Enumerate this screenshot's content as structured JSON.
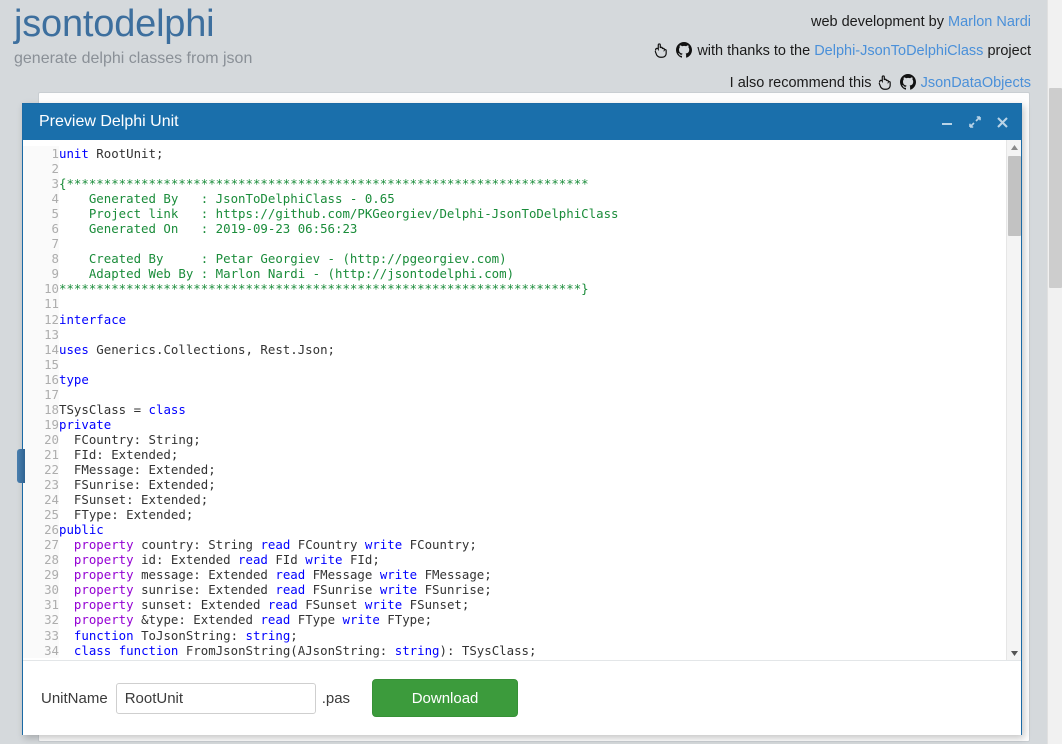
{
  "header": {
    "brand_title": "jsontodelphi",
    "brand_subtitle": "generate delphi classes from json",
    "credit_line1_prefix": "web development by",
    "credit_line1_link": "Marlon Nardi",
    "credit_line2_prefix": "with thanks to the",
    "credit_line2_link": "Delphi-JsonToDelphiClass",
    "credit_line2_suffix": "project",
    "credit_line3_prefix": "I also recommend this",
    "credit_line3_link": "JsonDataObjects",
    "icons": {
      "hand": "hand-pointer-icon",
      "github": "github-icon"
    },
    "colors": {
      "brand": "#3d6f9e",
      "link": "#4a90d9",
      "subtitle": "#8a9097"
    }
  },
  "dialog": {
    "title": "Preview Delphi Unit",
    "titlebar_color": "#1a6fab",
    "window_buttons": [
      {
        "name": "minimize-button",
        "glyph": "minimize"
      },
      {
        "name": "maximize-button",
        "glyph": "expand"
      },
      {
        "name": "close-button",
        "glyph": "close"
      }
    ]
  },
  "code": {
    "language": "delphi",
    "first_line": 1,
    "colors": {
      "keyword": "#0000ff",
      "property": "#9400d3",
      "comment": "#1a8c3a",
      "text": "#333333",
      "gutter": "#adadad"
    },
    "lines": [
      {
        "n": 1,
        "tokens": [
          {
            "t": "unit",
            "c": "k"
          },
          {
            "t": " RootUnit;",
            "c": "id"
          }
        ]
      },
      {
        "n": 2,
        "tokens": []
      },
      {
        "n": 3,
        "tokens": [
          {
            "t": "{**********************************************************************",
            "c": "cm"
          }
        ]
      },
      {
        "n": 4,
        "tokens": [
          {
            "t": "    Generated By   : JsonToDelphiClass - 0.65",
            "c": "cm"
          }
        ]
      },
      {
        "n": 5,
        "tokens": [
          {
            "t": "    Project link   : https://github.com/PKGeorgiev/Delphi-JsonToDelphiClass",
            "c": "cm"
          }
        ]
      },
      {
        "n": 6,
        "tokens": [
          {
            "t": "    Generated On   : 2019-09-23 06:56:23",
            "c": "cm"
          }
        ]
      },
      {
        "n": 7,
        "tokens": []
      },
      {
        "n": 8,
        "tokens": [
          {
            "t": "    Created By     : Petar Georgiev - (http://pgeorgiev.com)",
            "c": "cm"
          }
        ]
      },
      {
        "n": 9,
        "tokens": [
          {
            "t": "    Adapted Web By : Marlon Nardi - (http://jsontodelphi.com)",
            "c": "cm"
          }
        ]
      },
      {
        "n": 10,
        "tokens": [
          {
            "t": "**********************************************************************}",
            "c": "cm"
          }
        ]
      },
      {
        "n": 11,
        "tokens": []
      },
      {
        "n": 12,
        "tokens": [
          {
            "t": "interface",
            "c": "k"
          }
        ]
      },
      {
        "n": 13,
        "tokens": []
      },
      {
        "n": 14,
        "tokens": [
          {
            "t": "uses",
            "c": "k"
          },
          {
            "t": " Generics.Collections, Rest.Json;",
            "c": "id"
          }
        ]
      },
      {
        "n": 15,
        "tokens": []
      },
      {
        "n": 16,
        "tokens": [
          {
            "t": "type",
            "c": "k"
          }
        ]
      },
      {
        "n": 17,
        "tokens": []
      },
      {
        "n": 18,
        "tokens": [
          {
            "t": "TSysClass = ",
            "c": "id"
          },
          {
            "t": "class",
            "c": "k"
          }
        ]
      },
      {
        "n": 19,
        "tokens": [
          {
            "t": "private",
            "c": "k"
          }
        ]
      },
      {
        "n": 20,
        "tokens": [
          {
            "t": "  FCountry: String;",
            "c": "id"
          }
        ]
      },
      {
        "n": 21,
        "tokens": [
          {
            "t": "  FId: Extended;",
            "c": "id"
          }
        ]
      },
      {
        "n": 22,
        "tokens": [
          {
            "t": "  FMessage: Extended;",
            "c": "id"
          }
        ]
      },
      {
        "n": 23,
        "tokens": [
          {
            "t": "  FSunrise: Extended;",
            "c": "id"
          }
        ]
      },
      {
        "n": 24,
        "tokens": [
          {
            "t": "  FSunset: Extended;",
            "c": "id"
          }
        ]
      },
      {
        "n": 25,
        "tokens": [
          {
            "t": "  FType: Extended;",
            "c": "id"
          }
        ]
      },
      {
        "n": 26,
        "tokens": [
          {
            "t": "public",
            "c": "k"
          }
        ]
      },
      {
        "n": 27,
        "tokens": [
          {
            "t": "  ",
            "c": "id"
          },
          {
            "t": "property",
            "c": "kp"
          },
          {
            "t": " country: String ",
            "c": "id"
          },
          {
            "t": "read",
            "c": "k"
          },
          {
            "t": " FCountry ",
            "c": "id"
          },
          {
            "t": "write",
            "c": "k"
          },
          {
            "t": " FCountry;",
            "c": "id"
          }
        ]
      },
      {
        "n": 28,
        "tokens": [
          {
            "t": "  ",
            "c": "id"
          },
          {
            "t": "property",
            "c": "kp"
          },
          {
            "t": " id: Extended ",
            "c": "id"
          },
          {
            "t": "read",
            "c": "k"
          },
          {
            "t": " FId ",
            "c": "id"
          },
          {
            "t": "write",
            "c": "k"
          },
          {
            "t": " FId;",
            "c": "id"
          }
        ]
      },
      {
        "n": 29,
        "tokens": [
          {
            "t": "  ",
            "c": "id"
          },
          {
            "t": "property",
            "c": "kp"
          },
          {
            "t": " message: Extended ",
            "c": "id"
          },
          {
            "t": "read",
            "c": "k"
          },
          {
            "t": " FMessage ",
            "c": "id"
          },
          {
            "t": "write",
            "c": "k"
          },
          {
            "t": " FMessage;",
            "c": "id"
          }
        ]
      },
      {
        "n": 30,
        "tokens": [
          {
            "t": "  ",
            "c": "id"
          },
          {
            "t": "property",
            "c": "kp"
          },
          {
            "t": " sunrise: Extended ",
            "c": "id"
          },
          {
            "t": "read",
            "c": "k"
          },
          {
            "t": " FSunrise ",
            "c": "id"
          },
          {
            "t": "write",
            "c": "k"
          },
          {
            "t": " FSunrise;",
            "c": "id"
          }
        ]
      },
      {
        "n": 31,
        "tokens": [
          {
            "t": "  ",
            "c": "id"
          },
          {
            "t": "property",
            "c": "kp"
          },
          {
            "t": " sunset: Extended ",
            "c": "id"
          },
          {
            "t": "read",
            "c": "k"
          },
          {
            "t": " FSunset ",
            "c": "id"
          },
          {
            "t": "write",
            "c": "k"
          },
          {
            "t": " FSunset;",
            "c": "id"
          }
        ]
      },
      {
        "n": 32,
        "tokens": [
          {
            "t": "  ",
            "c": "id"
          },
          {
            "t": "property",
            "c": "kp"
          },
          {
            "t": " &type: Extended ",
            "c": "id"
          },
          {
            "t": "read",
            "c": "k"
          },
          {
            "t": " FType ",
            "c": "id"
          },
          {
            "t": "write",
            "c": "k"
          },
          {
            "t": " FType;",
            "c": "id"
          }
        ]
      },
      {
        "n": 33,
        "tokens": [
          {
            "t": "  ",
            "c": "id"
          },
          {
            "t": "function",
            "c": "k"
          },
          {
            "t": " ToJsonString: ",
            "c": "id"
          },
          {
            "t": "string",
            "c": "k"
          },
          {
            "t": ";",
            "c": "id"
          }
        ]
      },
      {
        "n": 34,
        "tokens": [
          {
            "t": "  ",
            "c": "id"
          },
          {
            "t": "class",
            "c": "k"
          },
          {
            "t": " ",
            "c": "id"
          },
          {
            "t": "function",
            "c": "k"
          },
          {
            "t": " FromJsonString(AJsonString: ",
            "c": "id"
          },
          {
            "t": "string",
            "c": "k"
          },
          {
            "t": "): TSysClass;",
            "c": "id"
          }
        ]
      }
    ]
  },
  "footer": {
    "unit_name_label": "UnitName",
    "unit_name_value": "RootUnit",
    "unit_name_placeholder": "RootUnit",
    "extension_label": ".pas",
    "download_label": "Download",
    "download_color": "#3c9b3c"
  }
}
